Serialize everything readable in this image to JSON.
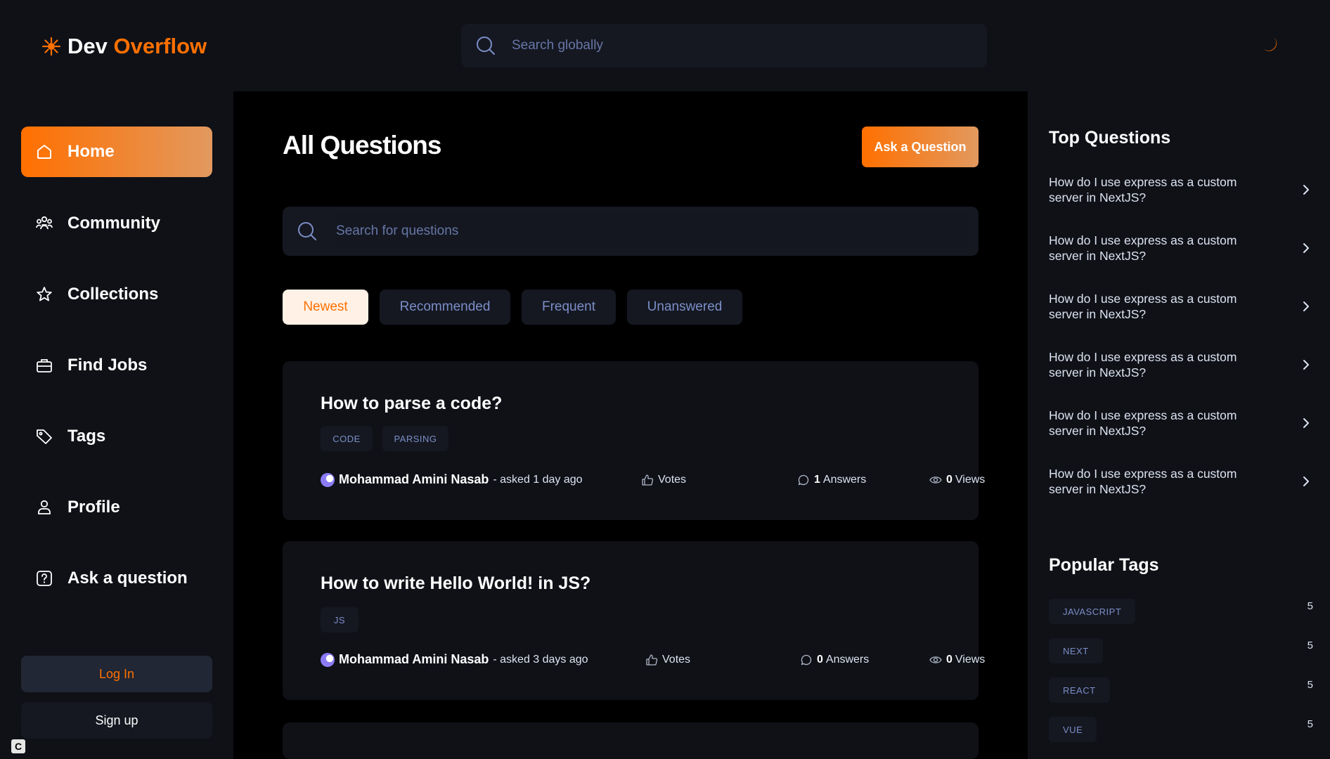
{
  "brand": {
    "dev": "Dev",
    "overflow": "Overflow"
  },
  "global_search": {
    "placeholder": "Search globally"
  },
  "sidebar": {
    "items": [
      {
        "label": "Home",
        "icon": "home-icon",
        "active": true
      },
      {
        "label": "Community",
        "icon": "users-icon"
      },
      {
        "label": "Collections",
        "icon": "star-icon"
      },
      {
        "label": "Find Jobs",
        "icon": "briefcase-icon"
      },
      {
        "label": "Tags",
        "icon": "tag-icon"
      },
      {
        "label": "Profile",
        "icon": "user-icon"
      },
      {
        "label": "Ask a question",
        "icon": "question-icon"
      }
    ],
    "login_label": "Log In",
    "signup_label": "Sign up"
  },
  "main": {
    "title": "All Questions",
    "ask_button": "Ask a Question",
    "search_placeholder": "Search for questions",
    "filters": [
      {
        "label": "Newest",
        "active": true
      },
      {
        "label": "Recommended"
      },
      {
        "label": "Frequent"
      },
      {
        "label": "Unanswered"
      }
    ],
    "questions": [
      {
        "title": "How to parse a code?",
        "tags": [
          "CODE",
          "PARSING"
        ],
        "author": "Mohammad Amini Nasab",
        "asked": "- asked 1 day ago",
        "votes_label": "Votes",
        "answers_count": "1",
        "answers_label": "Answers",
        "views_count": "0",
        "views_label": "Views"
      },
      {
        "title": "How to write Hello World! in JS?",
        "tags": [
          "JS"
        ],
        "author": "Mohammad Amini Nasab",
        "asked": "- asked 3 days ago",
        "votes_label": "Votes",
        "answers_count": "0",
        "answers_label": "Answers",
        "views_count": "0",
        "views_label": "Views"
      }
    ]
  },
  "right_sidebar": {
    "top_questions_title": "Top Questions",
    "top_questions": [
      "How do I use express as a custom server in NextJS?",
      "How do I use express as a custom server in NextJS?",
      "How do I use express as a custom server in NextJS?",
      "How do I use express as a custom server in NextJS?",
      "How do I use express as a custom server in NextJS?",
      "How do I use express as a custom server in NextJS?"
    ],
    "popular_tags_title": "Popular Tags",
    "popular_tags": [
      {
        "name": "JAVASCRIPT",
        "count": "5"
      },
      {
        "name": "NEXT",
        "count": "5"
      },
      {
        "name": "REACT",
        "count": "5"
      },
      {
        "name": "VUE",
        "count": "5"
      }
    ]
  },
  "colors": {
    "accent": "#ff7000",
    "accent_light": "#e2995f",
    "background": "#000000",
    "panel": "#0f1117",
    "chip": "#151821",
    "muted_text": "#7b8ec8"
  }
}
